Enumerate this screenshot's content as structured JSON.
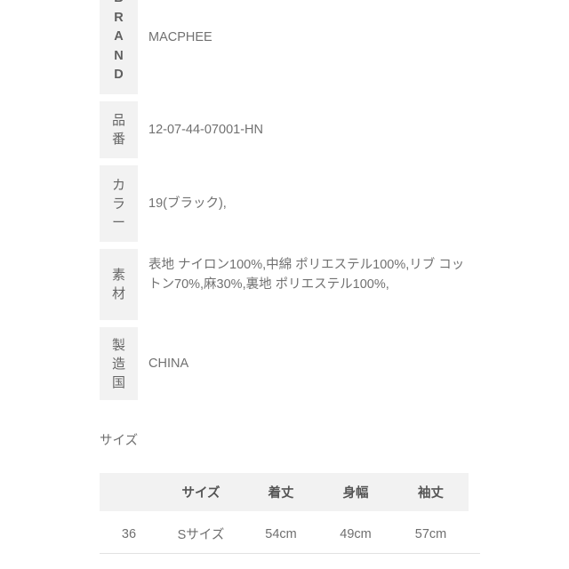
{
  "spec": {
    "rows": [
      {
        "label": "BRAND",
        "label_chars": [
          "B",
          "R",
          "A",
          "N",
          "D"
        ],
        "label_style": "latin",
        "value": "MACPHEE"
      },
      {
        "label": "品番",
        "label_chars": [
          "品",
          "番"
        ],
        "label_style": "cjk",
        "value": "12-07-44-07001-HN"
      },
      {
        "label": "カラー",
        "label_chars": [
          "カ",
          "ラ",
          "ー"
        ],
        "label_style": "cjk",
        "value": "19(ブラック),"
      },
      {
        "label": "素材",
        "label_chars": [
          "素",
          "材"
        ],
        "label_style": "cjk",
        "value": "表地 ナイロン100%,中綿 ポリエステル100%,リブ コットン70%,麻30%,裏地 ポリエステル100%,"
      },
      {
        "label": "製造国",
        "label_chars": [
          "製",
          "造",
          "国"
        ],
        "label_style": "cjk",
        "value": "CHINA"
      }
    ]
  },
  "size_section": {
    "heading": "サイズ",
    "columns": [
      "",
      "サイズ",
      "着丈",
      "身幅",
      "袖丈"
    ],
    "rows": [
      {
        "number": "36",
        "size": "Sサイズ",
        "length": "54cm",
        "width": "49cm",
        "sleeve": "57cm"
      }
    ]
  },
  "colors": {
    "label_chip_bg": "#f2f2f2",
    "text": "#6e6e6e",
    "rule": "#e2e2e2",
    "page_bg": "#ffffff"
  }
}
